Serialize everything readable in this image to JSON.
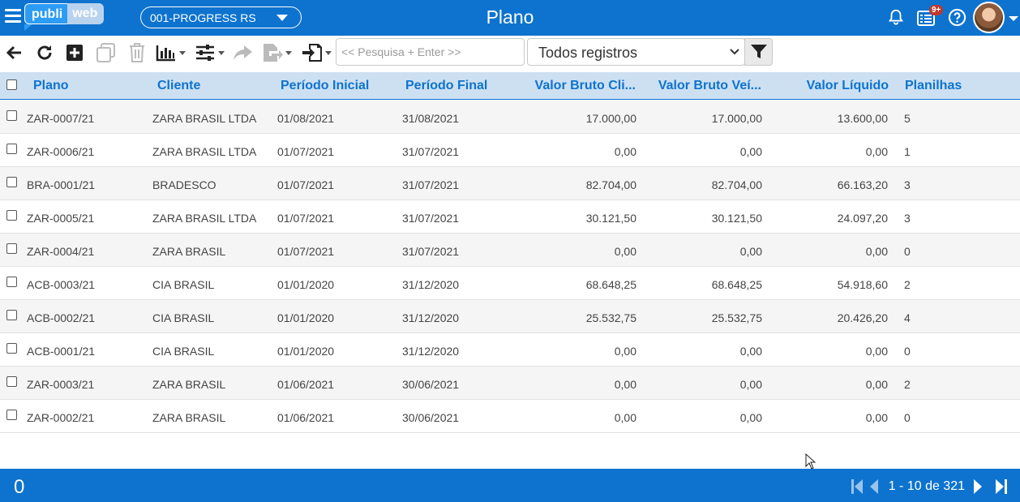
{
  "header": {
    "logo_left": "publi",
    "logo_right": "web",
    "company": "001-PROGRESS RS",
    "title": "Plano",
    "notification_badge": "9+",
    "icons": [
      "menu-icon",
      "bell-icon",
      "list-icon",
      "help-icon",
      "avatar"
    ]
  },
  "toolbar": {
    "icons": [
      "back-icon",
      "refresh-icon",
      "add-icon",
      "copy-icon",
      "delete-icon",
      "chart-icon",
      "settings-icon",
      "forward-icon",
      "export-icon",
      "import-icon"
    ],
    "search_placeholder": "<< Pesquisa + Enter >>",
    "filter_value": "Todos registros"
  },
  "table": {
    "columns": [
      "Plano",
      "Cliente",
      "Período Inicial",
      "Período Final",
      "Valor Bruto Cli...",
      "Valor Bruto Veí...",
      "Valor Líquido",
      "Planilhas"
    ],
    "rows": [
      [
        "ZAR-0007/21",
        "ZARA BRASIL LTDA",
        "01/08/2021",
        "31/08/2021",
        "17.000,00",
        "17.000,00",
        "13.600,00",
        "5"
      ],
      [
        "ZAR-0006/21",
        "ZARA BRASIL LTDA",
        "01/07/2021",
        "31/07/2021",
        "0,00",
        "0,00",
        "0,00",
        "1"
      ],
      [
        "BRA-0001/21",
        "BRADESCO",
        "01/07/2021",
        "31/07/2021",
        "82.704,00",
        "82.704,00",
        "66.163,20",
        "3"
      ],
      [
        "ZAR-0005/21",
        "ZARA BRASIL LTDA",
        "01/07/2021",
        "31/07/2021",
        "30.121,50",
        "30.121,50",
        "24.097,20",
        "3"
      ],
      [
        "ZAR-0004/21",
        "ZARA BRASIL",
        "01/07/2021",
        "31/07/2021",
        "0,00",
        "0,00",
        "0,00",
        "0"
      ],
      [
        "ACB-0003/21",
        "CIA BRASIL",
        "01/01/2020",
        "31/12/2020",
        "68.648,25",
        "68.648,25",
        "54.918,60",
        "2"
      ],
      [
        "ACB-0002/21",
        "CIA BRASIL",
        "01/01/2020",
        "31/12/2020",
        "25.532,75",
        "25.532,75",
        "20.426,20",
        "4"
      ],
      [
        "ACB-0001/21",
        "CIA BRASIL",
        "01/01/2020",
        "31/12/2020",
        "0,00",
        "0,00",
        "0,00",
        "0"
      ],
      [
        "ZAR-0003/21",
        "ZARA BRASIL",
        "01/06/2021",
        "30/06/2021",
        "0,00",
        "0,00",
        "0,00",
        "2"
      ],
      [
        "ZAR-0002/21",
        "ZARA BRASIL",
        "01/06/2021",
        "30/06/2021",
        "0,00",
        "0,00",
        "0,00",
        "0"
      ]
    ]
  },
  "footer": {
    "selected_count": "0",
    "pagination": "1 - 10 de 321"
  },
  "colors": {
    "primary": "#0d73cf",
    "header_row": "#cde0f2",
    "row_alt": "#f5f5f5",
    "badge": "#c0392b"
  }
}
